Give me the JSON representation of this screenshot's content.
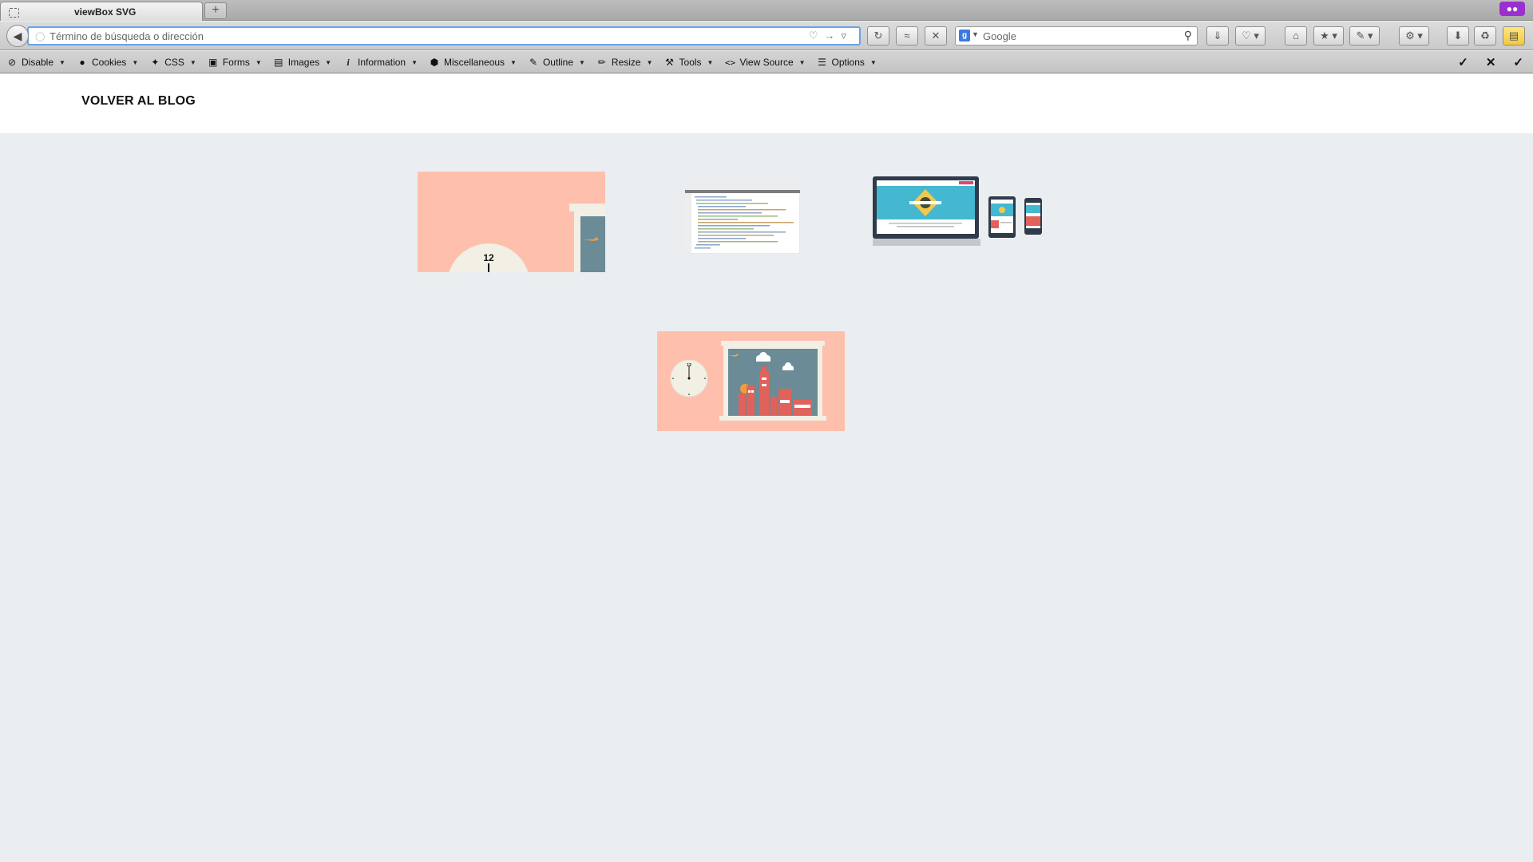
{
  "browser": {
    "tab_title": "viewBox SVG",
    "new_tab_label": "+",
    "address_placeholder": "Término de búsqueda o dirección",
    "search_placeholder": "Google",
    "search_engine_initial": "g"
  },
  "devtoolbar": {
    "items": [
      {
        "label": "Disable"
      },
      {
        "label": "Cookies"
      },
      {
        "label": "CSS"
      },
      {
        "label": "Forms"
      },
      {
        "label": "Images"
      },
      {
        "label": "Information"
      },
      {
        "label": "Miscellaneous"
      },
      {
        "label": "Outline"
      },
      {
        "label": "Resize"
      },
      {
        "label": "Tools"
      },
      {
        "label": "View Source"
      },
      {
        "label": "Options"
      }
    ]
  },
  "page": {
    "back_link": "VOLVER AL BLOG",
    "clock_number": "12",
    "clock_small_number": "12"
  },
  "colors": {
    "salmon": "#ffbfad",
    "slate": "#6b8b96",
    "cream": "#f2efe4",
    "brick": "#e0625a",
    "teal": "#45b8d1",
    "accent_purple": "#9b2fcf",
    "focus_blue": "#6aa3e8"
  }
}
